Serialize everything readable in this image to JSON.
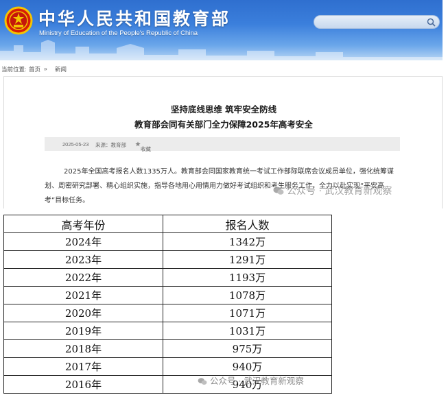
{
  "header": {
    "title_cn": "中华人民共和国教育部",
    "title_en": "Ministry of Education of the People's Republic of China",
    "search": {
      "placeholder": "",
      "icon": "search-icon"
    },
    "emblem": "national-emblem-icon"
  },
  "breadcrumb": {
    "label": "当前位置:",
    "items": [
      "首页",
      "新闻"
    ],
    "separator": "»"
  },
  "article": {
    "headline_1": "坚持底线思维 筑牢安全防线",
    "headline_2": "教育部会同有关部门全力保障2025年高考安全",
    "date": "2025-05-23",
    "source": "来源：教育部",
    "favorite_label": "收藏",
    "body_lines": [
      "2025年全国高考报名人数1335万人。教育部会同国家教育统一考试工作部际联席会议成员单位，强化统筹谋",
      "划、周密研究部署、精心组织实施，指导各地用心用情用力做好考试组织和考生服务工作，全力以赴实现“平安高",
      "考”目标任务。"
    ]
  },
  "watermarks": {
    "top": "公众号 · 武汉教育新观察",
    "bottom": "公众号 · 武汉教育新观察"
  },
  "table": {
    "headers": [
      "高考年份",
      "报名人数"
    ],
    "rows": [
      [
        "2024年",
        "1342万"
      ],
      [
        "2023年",
        "1291万"
      ],
      [
        "2022年",
        "1193万"
      ],
      [
        "2021年",
        "1078万"
      ],
      [
        "2020年",
        "1071万"
      ],
      [
        "2019年",
        "1031万"
      ],
      [
        "2018年",
        "975万"
      ],
      [
        "2017年",
        "940万"
      ],
      [
        "2016年",
        "940万"
      ]
    ]
  },
  "colors": {
    "banner_blue": "#3b7fdc",
    "meta_bar": "#ececec",
    "table_border": "#222222"
  }
}
